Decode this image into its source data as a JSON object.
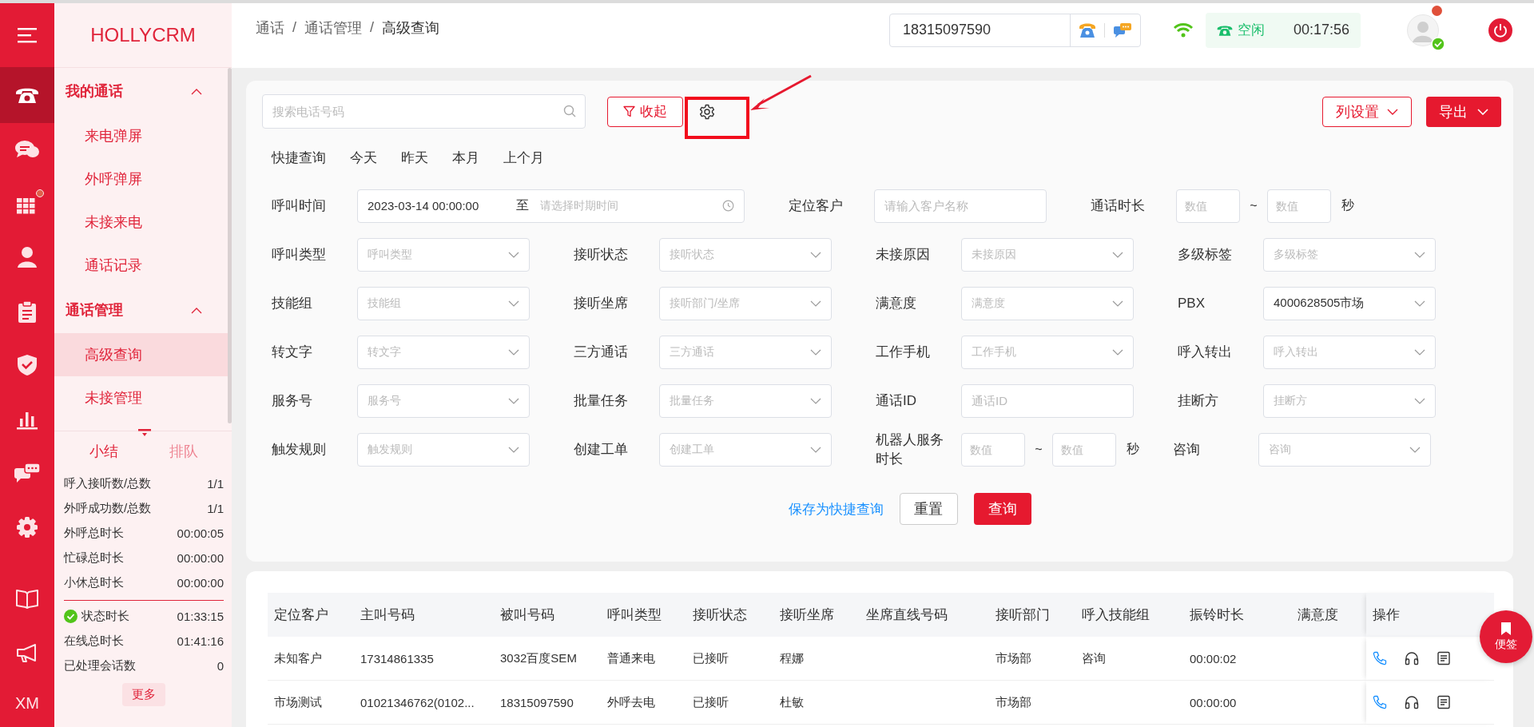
{
  "nav_rail": [
    {
      "selected": true,
      "dot": false
    },
    {
      "selected": false,
      "dot": false
    },
    {
      "selected": false,
      "dot": true
    },
    {
      "selected": false,
      "dot": false
    },
    {
      "selected": false,
      "dot": false
    },
    {
      "selected": false,
      "dot": false
    },
    {
      "selected": false,
      "dot": false
    },
    {
      "selected": false,
      "dot": false
    },
    {
      "selected": false,
      "dot": false
    },
    {
      "selected": false,
      "dot": false
    },
    {
      "selected": false,
      "dot": false
    }
  ],
  "nav_rail_user": "XM",
  "logo": "HOLLYCRM",
  "menu_groups": [
    {
      "title": "我的通话",
      "expanded": true,
      "items": [
        {
          "label": "来电弹屏",
          "selected": false
        },
        {
          "label": "外呼弹屏",
          "selected": false
        },
        {
          "label": "未接来电",
          "selected": false
        },
        {
          "label": "通话记录",
          "selected": false
        }
      ]
    },
    {
      "title": "通话管理",
      "expanded": true,
      "items": [
        {
          "label": "高级查询",
          "selected": true
        },
        {
          "label": "未接管理",
          "selected": false
        }
      ]
    }
  ],
  "summary_tabs": [
    {
      "label": "小结",
      "selected": true
    },
    {
      "label": "排队",
      "selected": false
    }
  ],
  "summary_rows": [
    {
      "label": "呼入接听数/总数",
      "value": "1/1"
    },
    {
      "label": "外呼成功数/总数",
      "value": "1/1"
    },
    {
      "label": "外呼总时长",
      "value": "00:00:05"
    },
    {
      "label": "忙碌总时长",
      "value": "00:00:00"
    },
    {
      "label": "小休总时长",
      "value": "00:00:00"
    }
  ],
  "session_rows": [
    {
      "kind": "status",
      "label": "状态时长",
      "value": "01:33:15"
    },
    {
      "kind": "plain",
      "label": "在线总时长",
      "value": "01:41:16"
    },
    {
      "kind": "plain",
      "label": "已处理会话数",
      "value": "0"
    }
  ],
  "more_button": "更多",
  "breadcrumb": [
    "通话",
    "通话管理",
    "高级查询"
  ],
  "breadcrumb_separator": "/",
  "phone_field": {
    "value": "18315097590"
  },
  "agent_status": {
    "label": "空闲",
    "timer": "00:17:56"
  },
  "avatar": {
    "has_notification": true,
    "online": true
  },
  "filter": {
    "search_placeholder": "搜索电话号码",
    "collapse": "收起",
    "column_settings": "列设置",
    "export": "导出",
    "quick_query": {
      "label": "快捷查询",
      "options": [
        {
          "label": "今天",
          "selected": false
        },
        {
          "label": "昨天",
          "selected": false
        },
        {
          "label": "本月",
          "selected": false
        },
        {
          "label": "上个月",
          "selected": false
        }
      ]
    },
    "call_time": {
      "label": "呼叫时间",
      "value": "2023-03-14 00:00:00",
      "separator": "至",
      "placeholder_end": "请选择时期时间"
    },
    "locate_customer": {
      "label": "定位客户",
      "placeholder": "请输入客户名称"
    },
    "call_duration": {
      "label": "通话时长",
      "placeholder_min": "数值",
      "separator": "~",
      "placeholder_max": "数值",
      "unit": "秒"
    },
    "rows": [
      [
        {
          "kind": "select",
          "label": "呼叫类型",
          "placeholder": "呼叫类型"
        },
        {
          "kind": "select",
          "label": "接听状态",
          "placeholder": "接听状态"
        },
        {
          "kind": "select",
          "label": "未接原因",
          "placeholder": "未接原因"
        },
        {
          "kind": "select",
          "label": "多级标签",
          "placeholder": "多级标签"
        }
      ],
      [
        {
          "kind": "select",
          "label": "技能组",
          "placeholder": "技能组"
        },
        {
          "kind": "select",
          "label": "接听坐席",
          "placeholder": "接听部门/坐席"
        },
        {
          "kind": "select",
          "label": "满意度",
          "placeholder": "满意度"
        },
        {
          "kind": "select",
          "label": "PBX",
          "value": "4000628505市场"
        }
      ],
      [
        {
          "kind": "select",
          "label": "转文字",
          "placeholder": "转文字"
        },
        {
          "kind": "select",
          "label": "三方通话",
          "placeholder": "三方通话"
        },
        {
          "kind": "select",
          "label": "工作手机",
          "placeholder": "工作手机"
        },
        {
          "kind": "select",
          "label": "呼入转出",
          "placeholder": "呼入转出"
        }
      ],
      [
        {
          "kind": "select",
          "label": "服务号",
          "placeholder": "服务号"
        },
        {
          "kind": "select",
          "label": "批量任务",
          "placeholder": "批量任务"
        },
        {
          "kind": "text",
          "label": "通话ID",
          "placeholder": "通话ID"
        },
        {
          "kind": "select",
          "label": "挂断方",
          "placeholder": "挂断方"
        }
      ],
      [
        {
          "kind": "select",
          "label": "触发规则",
          "placeholder": "触发规则"
        },
        {
          "kind": "select",
          "label": "创建工单",
          "placeholder": "创建工单"
        },
        {
          "kind": "numrange",
          "label": "机器人服务时长",
          "placeholder_min": "数值",
          "separator": "~",
          "placeholder_max": "数值",
          "unit": "秒"
        },
        {
          "kind": "select",
          "label": "咨询",
          "placeholder": "咨询"
        }
      ]
    ],
    "save_link": "保存为快捷查询",
    "reset": "重置",
    "search": "查询"
  },
  "table": {
    "columns": [
      "定位客户",
      "主叫号码",
      "被叫号码",
      "呼叫类型",
      "接听状态",
      "接听坐席",
      "坐席直线号码",
      "接听部门",
      "呼入技能组",
      "振铃时长",
      "满意度",
      "操作"
    ],
    "rows": [
      [
        "未知客户",
        "17314861335",
        "3032百度SEM",
        "普通来电",
        "已接听",
        "程娜",
        "",
        "市场部",
        "咨询",
        "00:00:02",
        ""
      ],
      [
        "市场测试",
        "01021346762(0102...",
        "18315097590",
        "外呼去电",
        "已接听",
        "杜敏",
        "",
        "市场部",
        "",
        "00:00:00",
        ""
      ]
    ]
  },
  "sticky_note": "便签"
}
